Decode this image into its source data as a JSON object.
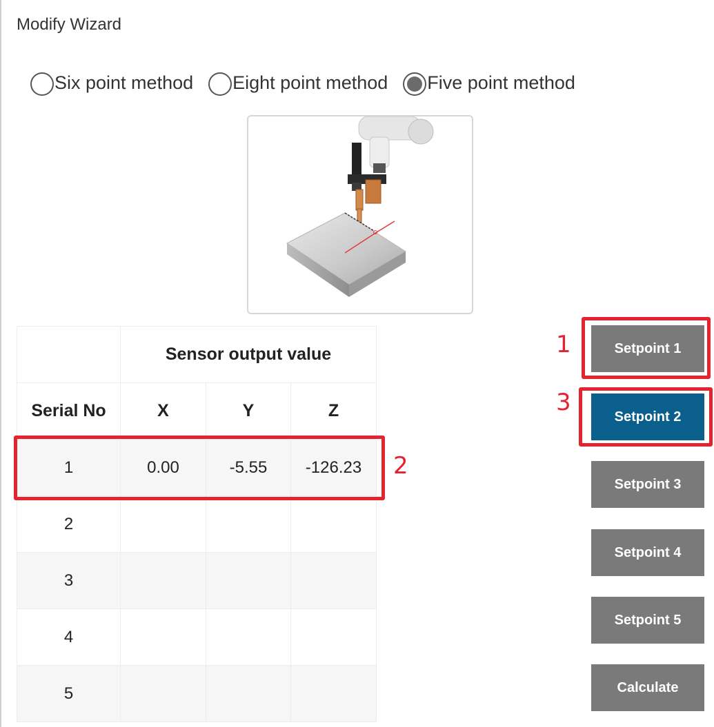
{
  "wizard": {
    "title": "Modify Wizard"
  },
  "methods": [
    {
      "label": "Six point method",
      "selected": false
    },
    {
      "label": "Eight point method",
      "selected": false
    },
    {
      "label": "Five point method",
      "selected": true
    }
  ],
  "table": {
    "group_header": "Sensor output value",
    "serial_header": "Serial No",
    "columns": [
      "X",
      "Y",
      "Z"
    ],
    "rows": [
      {
        "serial": "1",
        "x": "0.00",
        "y": "-5.55",
        "z": "-126.23"
      },
      {
        "serial": "2",
        "x": "",
        "y": "",
        "z": ""
      },
      {
        "serial": "3",
        "x": "",
        "y": "",
        "z": ""
      },
      {
        "serial": "4",
        "x": "",
        "y": "",
        "z": ""
      },
      {
        "serial": "5",
        "x": "",
        "y": "",
        "z": ""
      }
    ]
  },
  "buttons": [
    {
      "label": "Setpoint 1",
      "active": false
    },
    {
      "label": "Setpoint 2",
      "active": true
    },
    {
      "label": "Setpoint 3",
      "active": false
    },
    {
      "label": "Setpoint 4",
      "active": false
    },
    {
      "label": "Setpoint 5",
      "active": false
    },
    {
      "label": "Calculate",
      "active": false
    }
  ],
  "annotations": [
    "1",
    "2",
    "3"
  ],
  "colors": {
    "active_button": "#0a5f8c",
    "button": "#7a7a7a",
    "highlight": "#e4232f"
  }
}
